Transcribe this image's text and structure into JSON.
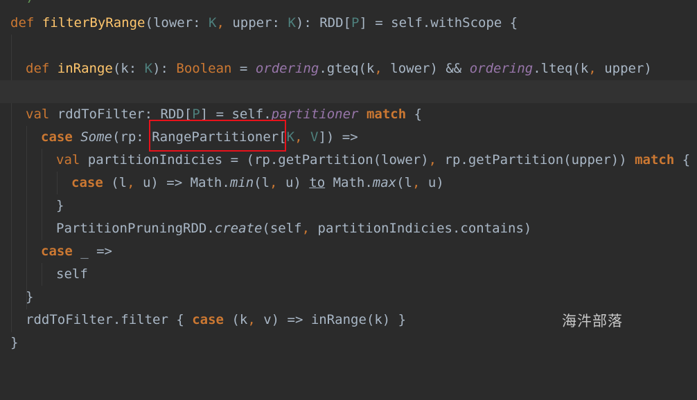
{
  "editor": {
    "theme_colors": {
      "background": "#2b2b2b",
      "current_line": "#323232",
      "keyword": "#cc7832",
      "function_decl": "#ffc66d",
      "type_param": "#4e807d",
      "field_italic": "#9876aa",
      "default_text": "#a9b7c6",
      "comment": "#629755",
      "highlight_box": "#e8121b"
    },
    "comment_fragment": "*/",
    "lines": {
      "l1": {
        "def": "def",
        "name": "filterByRange",
        "p1": "(lower: ",
        "K1": "K",
        "c1": ",",
        "p2": " upper: ",
        "K2": "K",
        "p3": "): RDD[",
        "P": "P",
        "p4": "] = self.withScope {"
      },
      "l3": {
        "def": "def",
        "name": "inRange",
        "p1": "(k: ",
        "K": "K",
        "p2": "): ",
        "bool": "Boolean",
        "p3": " = ",
        "ord1": "ordering",
        "p4": ".gteq(k",
        "c1": ",",
        "p5": " lower) && ",
        "ord2": "ordering",
        "p6": ".lteq(k",
        "c2": ",",
        "p7": " upper)"
      },
      "l5": {
        "val": "val",
        "p1": " rddToFilter: RDD[",
        "P": "P",
        "p2": "] = self.",
        "part": "partitioner",
        "match": "match",
        "p3": " {"
      },
      "l6": {
        "case": "case",
        "some": "Some",
        "p1": "(rp: ",
        "rp": "RangePartitioner[",
        "K": "K",
        "c1": ",",
        "p2": " ",
        "V": "V",
        "p3": "]) =>"
      },
      "l7": {
        "val": "val",
        "p1": " partitionIndicies = (rp.getPartition(lower)",
        "c1": ",",
        "p2": " rp.getPartition(upper)) ",
        "match": "match",
        "p3": " {"
      },
      "l8": {
        "case": "case",
        "p1": " (l",
        "c1": ",",
        "p2": " u) => Math.",
        "min": "min",
        "p3": "(l",
        "c2": ",",
        "p4": " u) ",
        "to": "to",
        "p5": " Math.",
        "max": "max",
        "p6": "(l",
        "c3": ",",
        "p7": " u)"
      },
      "l9": {
        "brace": "}"
      },
      "l10": {
        "p1": "PartitionPruningRDD.",
        "create": "create",
        "p2": "(self",
        "c1": ",",
        "p3": " partitionIndicies.contains)"
      },
      "l11": {
        "case": "case",
        "p1": " _ =>"
      },
      "l12": {
        "self": "self"
      },
      "l13": {
        "brace": "}"
      },
      "l14": {
        "p1": "rddToFilter.filter { ",
        "case": "case",
        "p2": " (k",
        "c1": ",",
        "p3": " v) => inRange(k) }"
      },
      "l15": {
        "brace": "}"
      }
    }
  },
  "watermark": "海汼部落"
}
